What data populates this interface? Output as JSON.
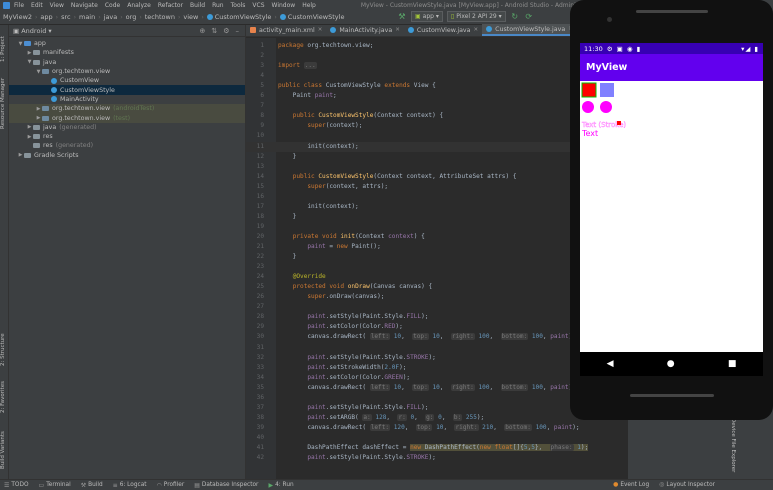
{
  "menubar": {
    "items": [
      "File",
      "Edit",
      "View",
      "Navigate",
      "Code",
      "Analyze",
      "Refactor",
      "Build",
      "Run",
      "Tools",
      "VCS",
      "Window",
      "Help"
    ],
    "title": "MyView - CustomViewStyle.java [MyView.app] - Android Studio - Administrator"
  },
  "navbar": {
    "crumbs": [
      "MyView2",
      "app",
      "src",
      "main",
      "java",
      "org",
      "techtown",
      "view",
      "CustomViewStyle",
      "CustomViewStyle"
    ],
    "run_config": "app",
    "device": "Pixel 2 API 29"
  },
  "left_strip": {
    "tabs": [
      "1: Project",
      "Resource Manager",
      "2: Structure",
      "2: Favorites",
      "Build Variants"
    ]
  },
  "project_panel": {
    "view_selector": "Android",
    "tree": [
      {
        "label": "app",
        "indent": 0,
        "kind": "module-folder",
        "arrow": "▼"
      },
      {
        "label": "manifests",
        "indent": 1,
        "kind": "folder",
        "arrow": "▶"
      },
      {
        "label": "java",
        "indent": 1,
        "kind": "folder",
        "arrow": "▼"
      },
      {
        "label": "org.techtown.view",
        "indent": 2,
        "kind": "package",
        "arrow": "▼"
      },
      {
        "label": "CustomView",
        "indent": 3,
        "kind": "class",
        "arrow": ""
      },
      {
        "label": "CustomViewStyle",
        "indent": 3,
        "kind": "class",
        "arrow": "",
        "selected": true
      },
      {
        "label": "MainActivity",
        "indent": 3,
        "kind": "class",
        "arrow": ""
      },
      {
        "label": "org.techtown.view",
        "indent": 2,
        "kind": "package",
        "arrow": "▶",
        "suffix": "(androidTest)",
        "module": true
      },
      {
        "label": "org.techtown.view",
        "indent": 2,
        "kind": "package",
        "arrow": "▶",
        "suffix": "(test)",
        "module": true
      },
      {
        "label": "java",
        "indent": 1,
        "kind": "folder",
        "arrow": "▶",
        "suffix": "(generated)"
      },
      {
        "label": "res",
        "indent": 1,
        "kind": "folder",
        "arrow": "▶"
      },
      {
        "label": "res",
        "indent": 1,
        "kind": "folder",
        "arrow": "",
        "suffix": "(generated)"
      },
      {
        "label": "Gradle Scripts",
        "indent": 0,
        "kind": "folder",
        "arrow": "▶"
      }
    ]
  },
  "editor": {
    "tabs": [
      {
        "label": "activity_main.xml",
        "type": "xml",
        "active": false
      },
      {
        "label": "MainActivity.java",
        "type": "java",
        "active": false
      },
      {
        "label": "CustomView.java",
        "type": "java",
        "active": false
      },
      {
        "label": "CustomViewStyle.java",
        "type": "java",
        "active": true
      }
    ],
    "current_line": 10,
    "lines": [
      {
        "n": 1,
        "html": "<span class=\"kw\">package</span> org.techtown.view;"
      },
      {
        "n": 2,
        "html": ""
      },
      {
        "n": 3,
        "html": "<span class=\"kw\">import</span> <span class=\"hint\">...</span>"
      },
      {
        "n": 7,
        "html": ""
      },
      {
        "n": 8,
        "html": "<span class=\"kw\">public class</span> CustomViewStyle <span class=\"kw\">extends</span> View {"
      },
      {
        "n": 9,
        "html": "    Paint <span class=\"field\">paint</span>;"
      },
      {
        "n": 10,
        "html": ""
      },
      {
        "n": 11,
        "html": "    <span class=\"kw\">public</span> <span class=\"fn\">CustomViewStyle</span>(Context context) {"
      },
      {
        "n": 12,
        "html": "        <span class=\"kw\">super</span>(context);"
      },
      {
        "n": 13,
        "html": ""
      },
      {
        "n": 10,
        "html": "        init(context);",
        "current": true
      },
      {
        "n": 11,
        "html": "    }"
      },
      {
        "n": 12,
        "html": ""
      },
      {
        "n": 13,
        "html": "    <span class=\"kw\">public</span> <span class=\"fn\">CustomViewStyle</span>(Context context, AttributeSet attrs) {"
      },
      {
        "n": 14,
        "html": "        <span class=\"kw\">super</span>(context, attrs);"
      },
      {
        "n": 15,
        "html": ""
      },
      {
        "n": 16,
        "html": "        init(context);"
      },
      {
        "n": 17,
        "html": "    }"
      },
      {
        "n": 18,
        "html": ""
      },
      {
        "n": 19,
        "html": "    <span class=\"kw\">private void</span> <span class=\"fn\">init</span>(Context <span class=\"field\">context</span>) {"
      },
      {
        "n": 20,
        "html": "        <span class=\"field\">paint</span> = <span class=\"kw\">new</span> Paint();"
      },
      {
        "n": 21,
        "html": "    }"
      },
      {
        "n": 22,
        "html": ""
      },
      {
        "n": 23,
        "html": "    <span class=\"ann\">@Override</span>"
      },
      {
        "n": 24,
        "html": "    <span class=\"kw\">protected void</span> <span class=\"fn\">onDraw</span>(Canvas canvas) {"
      },
      {
        "n": 25,
        "html": "        <span class=\"kw\">super</span>.onDraw(canvas);"
      },
      {
        "n": 26,
        "html": ""
      },
      {
        "n": 27,
        "html": "        <span class=\"field\">paint</span>.setStyle(Paint.Style.<span class=\"field\">FILL</span>);"
      },
      {
        "n": 28,
        "html": "        <span class=\"field\">paint</span>.setColor(Color.<span class=\"field\">RED</span>);"
      },
      {
        "n": 29,
        "html": "        canvas.drawRect( <span class=\"hint\">left:</span> <span class=\"num\">10</span>,  <span class=\"hint\">top:</span> <span class=\"num\">10</span>,  <span class=\"hint\">right:</span> <span class=\"num\">100</span>,  <span class=\"hint\">bottom:</span> <span class=\"num\">100</span>, <span class=\"field\">paint</span>);"
      },
      {
        "n": 30,
        "html": ""
      },
      {
        "n": 31,
        "html": "        <span class=\"field\">paint</span>.setStyle(Paint.Style.<span class=\"field\">STROKE</span>);"
      },
      {
        "n": 32,
        "html": "        <span class=\"field\">paint</span>.setStrokeWidth(<span class=\"num\">2.0F</span>);"
      },
      {
        "n": 33,
        "html": "        <span class=\"field\">paint</span>.setColor(Color.<span class=\"field\">GREEN</span>);"
      },
      {
        "n": 34,
        "html": "        canvas.drawRect( <span class=\"hint\">left:</span> <span class=\"num\">10</span>,  <span class=\"hint\">top:</span> <span class=\"num\">10</span>,  <span class=\"hint\">right:</span> <span class=\"num\">100</span>,  <span class=\"hint\">bottom:</span> <span class=\"num\">100</span>, <span class=\"field\">paint</span>);"
      },
      {
        "n": 35,
        "html": ""
      },
      {
        "n": 36,
        "html": "        <span class=\"field\">paint</span>.setStyle(Paint.Style.<span class=\"field\">FILL</span>);"
      },
      {
        "n": 37,
        "html": "        <span class=\"field\">paint</span>.setARGB( <span class=\"hint\">a:</span> <span class=\"num\">128</span>,  <span class=\"hint\">r:</span> <span class=\"num\">0</span>,  <span class=\"hint\">g:</span> <span class=\"num\">0</span>,  <span class=\"hint\">b:</span> <span class=\"num\">255</span>);"
      },
      {
        "n": 38,
        "html": "        canvas.drawRect( <span class=\"hint\">left:</span> <span class=\"num\">120</span>,  <span class=\"hint\">top:</span> <span class=\"num\">10</span>,  <span class=\"hint\">right:</span> <span class=\"num\">210</span>,  <span class=\"hint\">bottom:</span> <span class=\"num\">100</span>, <span class=\"field\">paint</span>);"
      },
      {
        "n": 39,
        "html": ""
      },
      {
        "n": 40,
        "html": "        DashPathEffect dashEffect = <span class=\"warn-hl\"><span class=\"kw\">new</span> DashPathEffect(<span class=\"kw\">new float</span>[]{<span class=\"num\">5</span>,<span class=\"num\">5</span>},  <span class=\"hint\">phase:</span> <span class=\"num\">1</span>);</span>"
      },
      {
        "n": 41,
        "html": "        <span class=\"field\">paint</span>.setStyle(Paint.Style.<span class=\"field\">STROKE</span>);"
      }
    ]
  },
  "emulator": {
    "time": "11:30",
    "app_title": "MyView",
    "text_small": "Text (Stroke)",
    "text_large": "Text",
    "colors": {
      "red": "#ff0000",
      "blue_alpha": "#8080ff",
      "magenta": "#ff00ff",
      "statusbar": "#3700b3",
      "appbar": "#6200ee"
    }
  },
  "right_strip": {
    "tab": "Device File Explorer"
  },
  "bottombar": {
    "left_items": [
      "TODO",
      "Terminal",
      "Build",
      "6: Logcat",
      "Profiler",
      "Database Inspector",
      "4: Run"
    ],
    "right_items": [
      "Event Log",
      "Layout Inspector"
    ]
  }
}
